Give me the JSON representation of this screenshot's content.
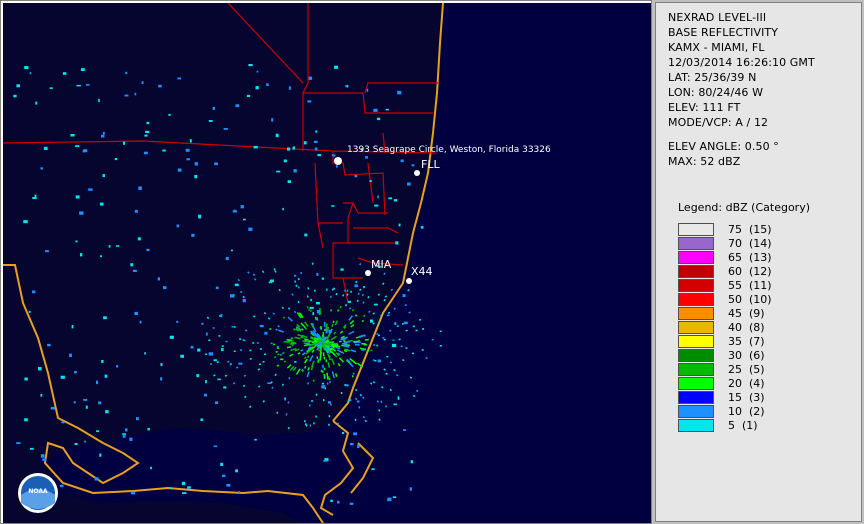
{
  "product": {
    "title_line1": "NEXRAD LEVEL-III",
    "title_line2": "BASE REFLECTIVITY",
    "station": "KAMX - MIAMI, FL",
    "datetime": "12/03/2014 16:26:10 GMT",
    "lat": "LAT: 25/36/39 N",
    "lon": "LON: 80/24/46 W",
    "elev": "ELEV: 111 FT",
    "mode": "MODE/VCP: A / 12",
    "elev_angle": "ELEV ANGLE: 0.50 °",
    "max": "MAX: 52 dBZ"
  },
  "legend": {
    "title": "Legend: dBZ (Category)",
    "entries": [
      {
        "label": "75  (15)",
        "color": "#e8e8e8"
      },
      {
        "label": "70  (14)",
        "color": "#9966cc"
      },
      {
        "label": "65  (13)",
        "color": "#ff00ff"
      },
      {
        "label": "60  (12)",
        "color": "#c00000"
      },
      {
        "label": "55  (11)",
        "color": "#d40000"
      },
      {
        "label": "50  (10)",
        "color": "#ff0000"
      },
      {
        "label": "45  (9)",
        "color": "#ff8c00"
      },
      {
        "label": "40  (8)",
        "color": "#e6b800"
      },
      {
        "label": "35  (7)",
        "color": "#ffff00"
      },
      {
        "label": "30  (6)",
        "color": "#008c00"
      },
      {
        "label": "25  (5)",
        "color": "#00bb00"
      },
      {
        "label": "20  (4)",
        "color": "#00ff00"
      },
      {
        "label": "15  (3)",
        "color": "#0000ff"
      },
      {
        "label": "10  (2)",
        "color": "#1e90ff"
      },
      {
        "label": "5  (1)",
        "color": "#00e5ee"
      }
    ]
  },
  "map": {
    "places": [
      {
        "id": "weston",
        "label": "1393 Seagrape Circle, Weston, Florida 33326"
      },
      {
        "id": "fll",
        "label": "FLL"
      },
      {
        "id": "mia",
        "label": "MIA"
      },
      {
        "id": "x44",
        "label": "X44"
      }
    ],
    "logo_text": "NOAA",
    "colors": {
      "background": "#000033",
      "land": "#05052a",
      "coastline": "#e8a020",
      "county_lines": "#cc0000",
      "marker": "#ffffff"
    }
  }
}
